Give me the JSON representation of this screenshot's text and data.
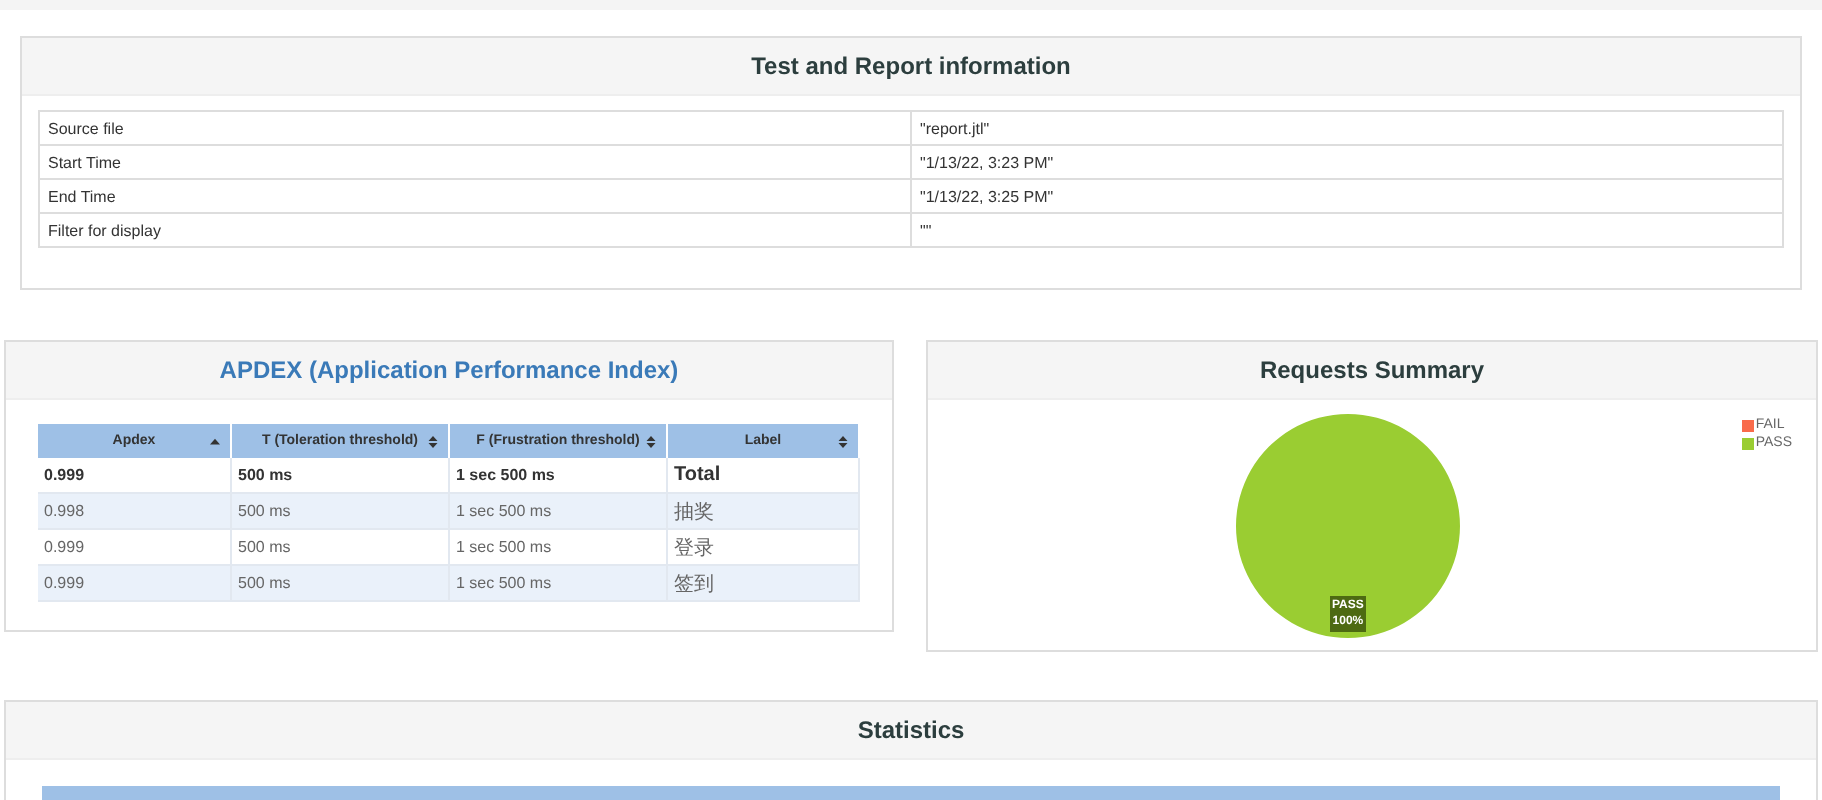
{
  "info_panel": {
    "title": "Test and Report information",
    "rows": [
      {
        "name": "Source file",
        "value": "\"report.jtl\""
      },
      {
        "name": "Start Time",
        "value": "\"1/13/22, 3:23 PM\""
      },
      {
        "name": "End Time",
        "value": "\"1/13/22, 3:25 PM\""
      },
      {
        "name": "Filter for display",
        "value": "\"\""
      }
    ]
  },
  "apdex_panel": {
    "title": "APDEX (Application Performance Index)",
    "columns": [
      {
        "label": "Apdex",
        "kind": "ascending"
      },
      {
        "label": "T (Toleration threshold)",
        "kind": "sortable"
      },
      {
        "label": "F (Frustration threshold)",
        "kind": "sortable"
      },
      {
        "label": "Label",
        "kind": "sortable"
      }
    ],
    "rows": [
      {
        "kind": "total",
        "cells": [
          "0.999",
          "500 ms",
          "1 sec 500 ms",
          "Total"
        ]
      },
      {
        "kind": "item",
        "cells": [
          "0.998",
          "500 ms",
          "1 sec 500 ms",
          "抽奖"
        ]
      },
      {
        "kind": "item",
        "cells": [
          "0.999",
          "500 ms",
          "1 sec 500 ms",
          "登录"
        ]
      },
      {
        "kind": "item",
        "cells": [
          "0.999",
          "500 ms",
          "1 sec 500 ms",
          "签到"
        ]
      }
    ]
  },
  "summary_panel": {
    "title": "Requests Summary",
    "legend": [
      {
        "color": "#f96b4b"
      },
      {
        "color": "#9acd32"
      }
    ],
    "chart_data": {
      "type": "pie",
      "categories": [
        "FAIL",
        "PASS"
      ],
      "series": [
        {
          "values": [
            0,
            100
          ]
        }
      ],
      "value_labels": [
        null,
        "100%"
      ]
    }
  },
  "statistics_panel": {
    "title": "Statistics"
  }
}
